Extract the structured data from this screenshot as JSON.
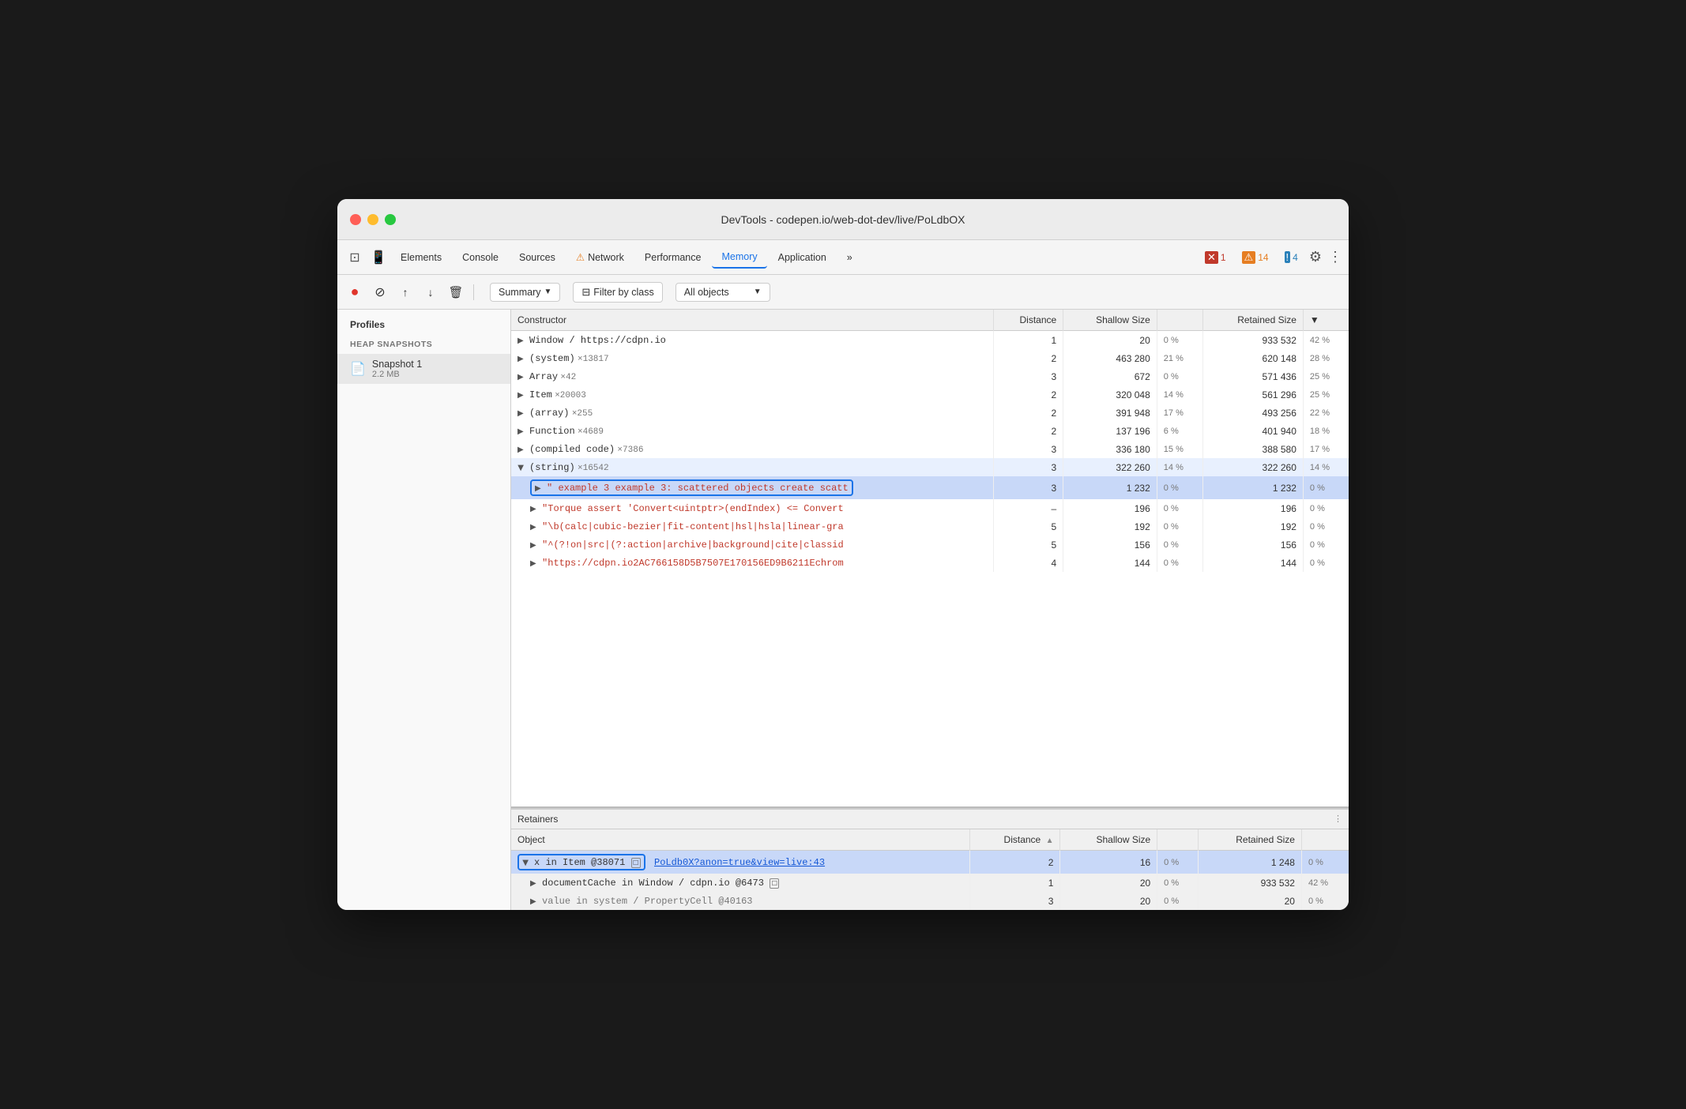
{
  "window": {
    "title": "DevTools - codepen.io/web-dot-dev/live/PoLdbOX"
  },
  "tabs": {
    "items": [
      {
        "label": "Elements",
        "active": false
      },
      {
        "label": "Console",
        "active": false
      },
      {
        "label": "Sources",
        "active": false
      },
      {
        "label": "⚠ Network",
        "active": false
      },
      {
        "label": "Performance",
        "active": false
      },
      {
        "label": "Memory",
        "active": true
      },
      {
        "label": "Application",
        "active": false
      },
      {
        "label": "»",
        "active": false
      }
    ],
    "badges": {
      "error": {
        "icon": "✕",
        "count": "1"
      },
      "warn": {
        "icon": "⚠",
        "count": "14"
      },
      "info": {
        "icon": "!",
        "count": "4"
      }
    }
  },
  "toolbar": {
    "summary_label": "Summary",
    "filter_label": "Filter by class",
    "all_objects_label": "All objects"
  },
  "sidebar": {
    "title": "Profiles",
    "section_label": "HEAP SNAPSHOTS",
    "snapshot": {
      "name": "Snapshot 1",
      "size": "2.2 MB"
    }
  },
  "constructor_table": {
    "headers": [
      "Constructor",
      "Distance",
      "Shallow Size",
      "",
      "Retained Size",
      "▼"
    ],
    "rows": [
      {
        "name": "Window / https://cdpn.io",
        "distance": "1",
        "shallow": "20",
        "shallow_pct": "0 %",
        "retained": "933 532",
        "retained_pct": "42 %",
        "indent": 0,
        "expanded": false
      },
      {
        "name": "(system)  ×13817",
        "distance": "2",
        "shallow": "463 280",
        "shallow_pct": "21 %",
        "retained": "620 148",
        "retained_pct": "28 %",
        "indent": 0,
        "expanded": false
      },
      {
        "name": "Array  ×42",
        "distance": "3",
        "shallow": "672",
        "shallow_pct": "0 %",
        "retained": "571 436",
        "retained_pct": "25 %",
        "indent": 0,
        "expanded": false
      },
      {
        "name": "Item  ×20003",
        "distance": "2",
        "shallow": "320 048",
        "shallow_pct": "14 %",
        "retained": "561 296",
        "retained_pct": "25 %",
        "indent": 0,
        "expanded": false
      },
      {
        "name": "(array)  ×255",
        "distance": "2",
        "shallow": "391 948",
        "shallow_pct": "17 %",
        "retained": "493 256",
        "retained_pct": "22 %",
        "indent": 0,
        "expanded": false
      },
      {
        "name": "Function  ×4689",
        "distance": "2",
        "shallow": "137 196",
        "shallow_pct": "6 %",
        "retained": "401 940",
        "retained_pct": "18 %",
        "indent": 0,
        "expanded": false
      },
      {
        "name": "(compiled code)  ×7386",
        "distance": "3",
        "shallow": "336 180",
        "shallow_pct": "15 %",
        "retained": "388 580",
        "retained_pct": "17 %",
        "indent": 0,
        "expanded": false
      },
      {
        "name": "(string)  ×16542",
        "distance": "3",
        "shallow": "322 260",
        "shallow_pct": "14 %",
        "retained": "322 260",
        "retained_pct": "14 %",
        "indent": 0,
        "expanded": true,
        "selected": true
      }
    ],
    "string_children": [
      {
        "name": "\" example 3 example 3: scattered objects create scatt",
        "distance": "3",
        "shallow": "1 232",
        "shallow_pct": "0 %",
        "retained": "1 232",
        "retained_pct": "0 %",
        "selected": true,
        "outlined": true
      },
      {
        "name": "\"Torque assert 'Convert<uintptr>(endIndex) <= Convert",
        "distance": "–",
        "shallow": "196",
        "shallow_pct": "0 %",
        "retained": "196",
        "retained_pct": "0 %",
        "red": true
      },
      {
        "name": "\"\\b(calc|cubic-bezier|fit-content|hsl|hsla|linear-gra",
        "distance": "5",
        "shallow": "192",
        "shallow_pct": "0 %",
        "retained": "192",
        "retained_pct": "0 %",
        "red": true
      },
      {
        "name": "\"^(?!on|src|(?:action|archive|background|cite|classid",
        "distance": "5",
        "shallow": "156",
        "shallow_pct": "0 %",
        "retained": "156",
        "retained_pct": "0 %",
        "red": true
      },
      {
        "name": "\"https://cdpn.io2AC766158D5B7507E170156ED9B6211Echrom",
        "distance": "4",
        "shallow": "144",
        "shallow_pct": "0 %",
        "retained": "144",
        "retained_pct": "0 %",
        "red": true
      }
    ]
  },
  "retainers_table": {
    "section_label": "Retainers",
    "headers": [
      "Object",
      "Distance ▲",
      "Shallow Size",
      "",
      "Retained Size",
      ""
    ],
    "rows": [
      {
        "name": "x in Item @38071",
        "link": "PoLdb0X?anon=true&view=live:43",
        "distance": "2",
        "shallow": "16",
        "shallow_pct": "0 %",
        "retained": "1 248",
        "retained_pct": "0 %",
        "selected": true,
        "outlined": true
      },
      {
        "name": "documentCache in Window / cdpn.io @6473",
        "distance": "1",
        "shallow": "20",
        "shallow_pct": "0 %",
        "retained": "933 532",
        "retained_pct": "42 %",
        "indent": 1
      },
      {
        "name": "value in system / PropertyCell @40163",
        "distance": "3",
        "shallow": "20",
        "shallow_pct": "0 %",
        "retained": "20",
        "retained_pct": "0 %",
        "indent": 1
      }
    ]
  }
}
